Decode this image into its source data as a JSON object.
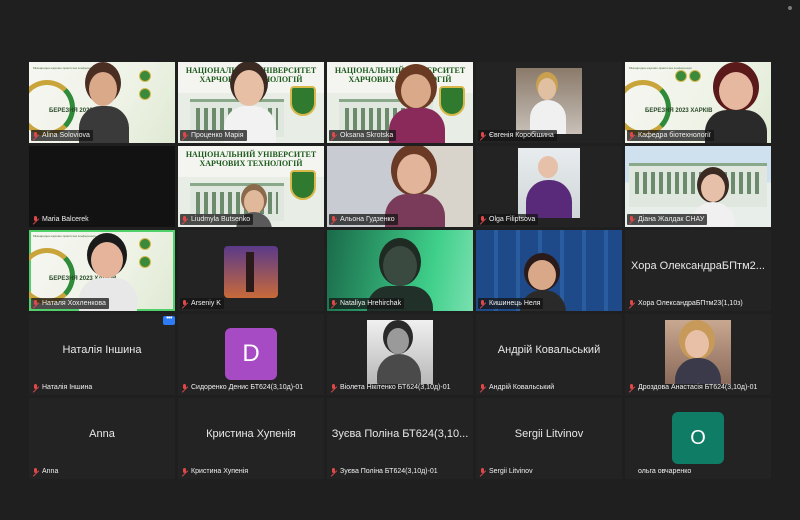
{
  "colors": {
    "window_bg": "#1f1f1f",
    "tile_bg": "#232323",
    "active_speaker_border": "#4fd06a",
    "muted_mic": "#e04848",
    "avatar_purple": "#a74bc4",
    "avatar_teal": "#0f7c66",
    "more_button": "#2d7cf6"
  },
  "gallery": {
    "uni_title": "НАЦІОНАЛЬНИЙ УНІВЕРСИТЕТ ХАРЧОВИХ ТЕХНОЛОГІЙ",
    "conf_year_text": "БЕРЕЗНЯ 2023 ХАРКІВ",
    "participants": [
      {
        "name": "Alina Soloviova"
      },
      {
        "name": "Проценко Марія"
      },
      {
        "name": "Oksana Skrotska"
      },
      {
        "name": "Євгенія Коробішина"
      },
      {
        "name": "Кафедра біотехнології"
      },
      {
        "name": "Maria Balcerek"
      },
      {
        "name": "Liudmyla Butsenko"
      },
      {
        "name": "Альона Гудзенко"
      },
      {
        "name": "Olga Filiptsova"
      },
      {
        "name": "Діана Жалдак СНАУ"
      },
      {
        "name": "Наталя Хохленкова"
      },
      {
        "name": "Arseniy K"
      },
      {
        "name": "Nataliya Hrehirchak"
      },
      {
        "name": "Кишинець Неля"
      },
      {
        "name": "Хора ОлександраБПтм23(1,10з)",
        "display": "Хора ОлександраБПтм2..."
      },
      {
        "name": "Наталія Іншина",
        "display": "Наталія Іншина"
      },
      {
        "name": "Сидоренко Денис БТ624(3,10д)-01",
        "avatar": "D"
      },
      {
        "name": "Віолета Нікітенко БТ624(3,10д)-01"
      },
      {
        "name": "Андрій Ковальський",
        "display": "Андрій Ковальський"
      },
      {
        "name": "Дроздова Анастасія БТ624(3,10д)-01"
      },
      {
        "name": "Anna",
        "display": "Anna"
      },
      {
        "name": "Кристина Хупенія",
        "display": "Кристина Хупенія"
      },
      {
        "name": "Зуєва Поліна БТ624(3,10д)-01",
        "display": "Зуєва Поліна БТ624(3,10..."
      },
      {
        "name": "Sergii Litvinov",
        "display": "Sergii Litvinov"
      },
      {
        "name": "ольга овчаренко",
        "avatar": "O"
      }
    ],
    "more_label": "•••"
  }
}
